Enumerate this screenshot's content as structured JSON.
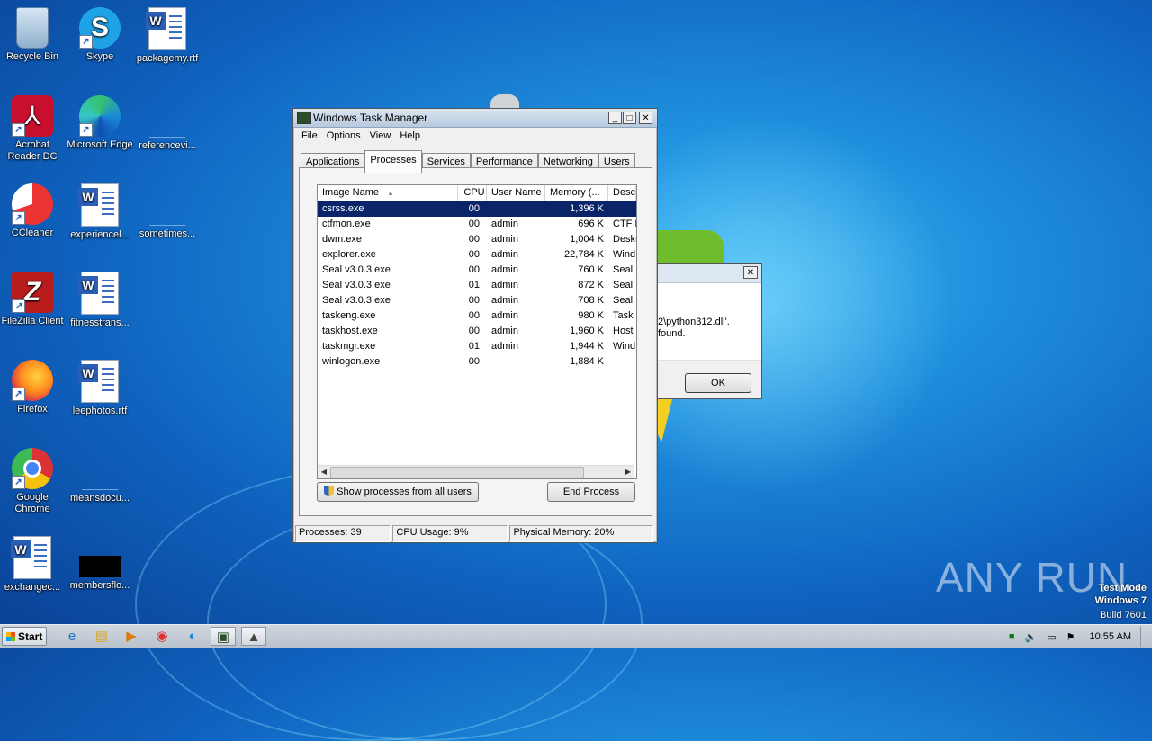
{
  "desktop": {
    "icons": [
      {
        "label": "Recycle Bin",
        "icon": "recycle-bin-icon"
      },
      {
        "label": "Skype",
        "icon": "skype-icon"
      },
      {
        "label": "packagemy.rtf",
        "icon": "word-document-icon"
      },
      {
        "label": "Acrobat Reader DC",
        "icon": "acrobat-icon"
      },
      {
        "label": "Microsoft Edge",
        "icon": "edge-icon"
      },
      {
        "label": "referencevi...",
        "icon": "blank-file-icon"
      },
      {
        "label": "CCleaner",
        "icon": "ccleaner-icon"
      },
      {
        "label": "experiencel...",
        "icon": "word-document-icon"
      },
      {
        "label": "sometimes...",
        "icon": "blank-file-icon"
      },
      {
        "label": "FileZilla Client",
        "icon": "filezilla-icon"
      },
      {
        "label": "fitnesstrans...",
        "icon": "word-document-icon"
      },
      {
        "label": "Firefox",
        "icon": "firefox-icon"
      },
      {
        "label": "leephotos.rtf",
        "icon": "word-document-icon"
      },
      {
        "label": "Google Chrome",
        "icon": "chrome-icon"
      },
      {
        "label": "meansdocu...",
        "icon": "blank-file-icon"
      },
      {
        "label": "exchangec...",
        "icon": "word-document-icon"
      },
      {
        "label": "membersflo...",
        "icon": "black-thumbnail-icon"
      }
    ]
  },
  "taskmgr": {
    "title": "Windows Task Manager",
    "menu": [
      "File",
      "Options",
      "View",
      "Help"
    ],
    "tabs": [
      "Applications",
      "Processes",
      "Services",
      "Performance",
      "Networking",
      "Users"
    ],
    "active_tab": "Processes",
    "columns": [
      "Image Name",
      "CPU",
      "User Name",
      "Memory (...",
      "Desc"
    ],
    "rows": [
      {
        "name": "csrss.exe",
        "cpu": "00",
        "user": "",
        "mem": "1,396 K",
        "desc": "",
        "selected": true
      },
      {
        "name": "ctfmon.exe",
        "cpu": "00",
        "user": "admin",
        "mem": "696 K",
        "desc": "CTF L"
      },
      {
        "name": "dwm.exe",
        "cpu": "00",
        "user": "admin",
        "mem": "1,004 K",
        "desc": "Deskt"
      },
      {
        "name": "explorer.exe",
        "cpu": "00",
        "user": "admin",
        "mem": "22,784 K",
        "desc": "Wind"
      },
      {
        "name": "Seal v3.0.3.exe",
        "cpu": "00",
        "user": "admin",
        "mem": "760 K",
        "desc": "Seal"
      },
      {
        "name": "Seal v3.0.3.exe",
        "cpu": "01",
        "user": "admin",
        "mem": "872 K",
        "desc": "Seal"
      },
      {
        "name": "Seal v3.0.3.exe",
        "cpu": "00",
        "user": "admin",
        "mem": "708 K",
        "desc": "Seal"
      },
      {
        "name": "taskeng.exe",
        "cpu": "00",
        "user": "admin",
        "mem": "980 K",
        "desc": "Task"
      },
      {
        "name": "taskhost.exe",
        "cpu": "00",
        "user": "admin",
        "mem": "1,960 K",
        "desc": "Host"
      },
      {
        "name": "taskmgr.exe",
        "cpu": "01",
        "user": "admin",
        "mem": "1,944 K",
        "desc": "Wind"
      },
      {
        "name": "winlogon.exe",
        "cpu": "00",
        "user": "",
        "mem": "1,884 K",
        "desc": ""
      }
    ],
    "show_all_label": "Show processes from all users",
    "end_process_label": "End Process",
    "status": {
      "processes": "Processes: 39",
      "cpu": "CPU Usage: 9%",
      "memory": "Physical Memory: 20%"
    }
  },
  "error_dialog": {
    "text_line1": "2\\python312.dll'.",
    "text_line2": "found.",
    "ok_label": "OK"
  },
  "taskbar": {
    "start_label": "Start",
    "clock": "10:55 AM"
  },
  "watermark": {
    "line1": "Test Mode",
    "line2": "Windows 7",
    "line3": "Build 7601",
    "brand": "ANY RUN"
  }
}
